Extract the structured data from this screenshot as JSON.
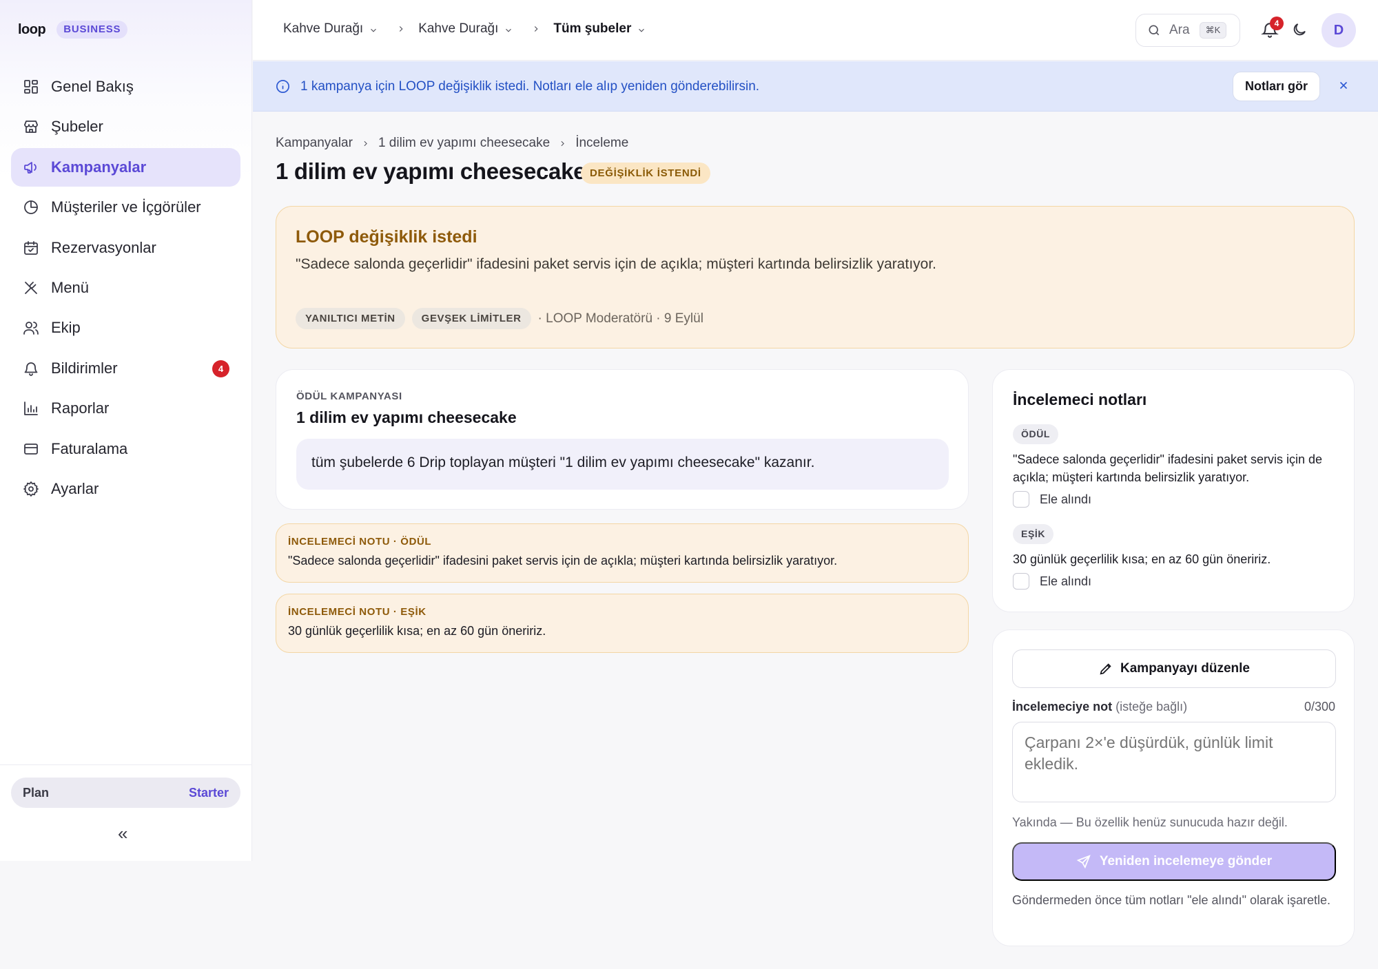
{
  "brand": {
    "logo": "loop",
    "badge": "BUSINESS"
  },
  "sidebar": {
    "items": [
      {
        "label": "Genel Bakış",
        "icon": "grid-icon"
      },
      {
        "label": "Şubeler",
        "icon": "store-icon"
      },
      {
        "label": "Kampanyalar",
        "icon": "megaphone-icon",
        "active": true
      },
      {
        "label": "Müşteriler ve İçgörüler",
        "icon": "pie-chart-icon"
      },
      {
        "label": "Rezervasyonlar",
        "icon": "calendar-icon"
      },
      {
        "label": "Menü",
        "icon": "utensils-icon"
      },
      {
        "label": "Ekip",
        "icon": "users-icon"
      },
      {
        "label": "Bildirimler",
        "icon": "bell-icon",
        "badge": "4"
      },
      {
        "label": "Raporlar",
        "icon": "bar-chart-icon"
      },
      {
        "label": "Faturalama",
        "icon": "credit-card-icon"
      },
      {
        "label": "Ayarlar",
        "icon": "gear-icon"
      }
    ],
    "plan": {
      "label": "Plan",
      "value": "Starter"
    },
    "collapse": "«"
  },
  "topbar": {
    "selectors": [
      "Kahve Durağı",
      "Kahve Durağı",
      "Tüm şubeler"
    ],
    "search": {
      "placeholder": "Ara",
      "shortcut": "⌘K"
    },
    "notification_count": "4",
    "avatar_initial": "D"
  },
  "banner": {
    "text": "1 kampanya için LOOP değişiklik istedi. Notları ele alıp yeniden gönderebilirsin.",
    "button": "Notları gör"
  },
  "breadcrumb": [
    "Kampanyalar",
    "1 dilim ev yapımı cheesecake",
    "İnceleme"
  ],
  "page": {
    "title": "1 dilim ev yapımı cheesecake",
    "status": "DEĞİŞİKLİK İSTENDİ"
  },
  "alert": {
    "title": "LOOP değişiklik istedi",
    "body": "\"Sadece salonda geçerlidir\" ifadesini paket servis için de açıkla; müşteri kartında belirsizlik yaratıyor.",
    "tags": [
      "YANILTICI METİN",
      "GEVŞEK LİMİTLER"
    ],
    "meta": "· LOOP Moderatörü · 9 Eylül"
  },
  "reward": {
    "kicker": "ÖDÜL KAMPANYASI",
    "title": "1 dilim ev yapımı cheesecake",
    "rule": "tüm şubelerde 6 Drip toplayan müşteri \"1 dilim ev yapımı cheesecake\" kazanır."
  },
  "inline_notes": [
    {
      "kicker": "İNCELEMECİ NOTU · ÖDÜL",
      "text": "\"Sadece salonda geçerlidir\" ifadesini paket servis için de açıkla; müşteri kartında belirsizlik yaratıyor."
    },
    {
      "kicker": "İNCELEMECİ NOTU · EŞİK",
      "text": "30 günlük geçerlilik kısa; en az 60 gün öneririz."
    }
  ],
  "reviewer": {
    "title": "İncelemeci notları",
    "notes": [
      {
        "pill": "ÖDÜL",
        "text": "\"Sadece salonda geçerlidir\" ifadesini paket servis için de açıkla; müşteri kartında belirsizlik yaratıyor.",
        "check_label": "Ele alındı"
      },
      {
        "pill": "EŞİK",
        "text": "30 günlük geçerlilik kısa; en az 60 gün öneririz.",
        "check_label": "Ele alındı"
      }
    ]
  },
  "actions": {
    "edit_label": "Kampanyayı düzenle",
    "field_label": "İncelemeciye not",
    "field_optional": "(isteğe bağlı)",
    "counter": "0/300",
    "placeholder": "Çarpanı 2×'e düşürdük, günlük limit ekledik.",
    "soon": "Yakında — Bu özellik henüz sunucuda hazır değil.",
    "submit_label": "Yeniden incelemeye gönder",
    "hint": "Göndermeden önce tüm notları \"ele alındı\" olarak işaretle."
  },
  "colors": {
    "accent": "#5b49d6",
    "banner_bg": "#e0e7fb",
    "warning_bg": "#fcf1e3",
    "danger": "#d6232a"
  }
}
